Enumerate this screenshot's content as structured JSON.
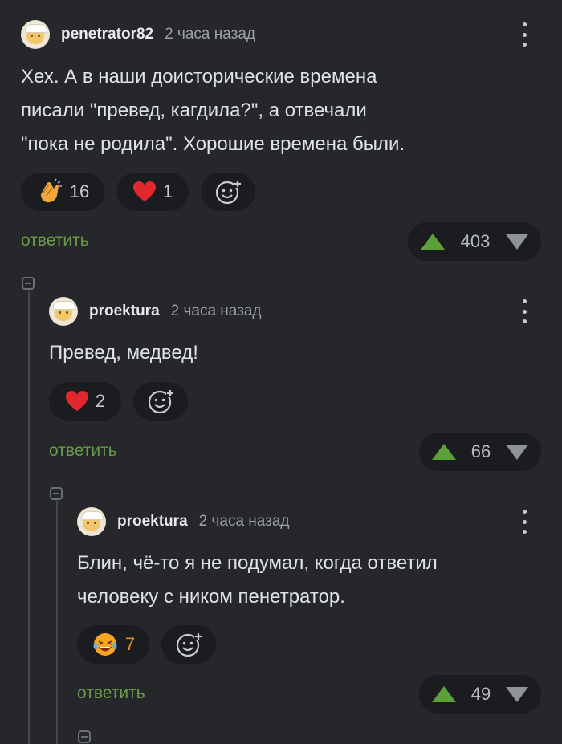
{
  "comments": [
    {
      "author": "penetrator82",
      "time": "2 часа назад",
      "lines": [
        "Хех. А в наши доисторические времена",
        "писали \"превед, кагдила?\", а отвечали",
        "\"пока не родила\". Хорошие времена были."
      ],
      "reactions": [
        {
          "icon": "clap-icon",
          "count": "16"
        },
        {
          "icon": "heart-icon",
          "count": "1"
        }
      ],
      "reply_label": "ответить",
      "rating": "403"
    },
    {
      "author": "proektura",
      "time": "2 часа назад",
      "lines": [
        "Превед, медвед!"
      ],
      "reactions": [
        {
          "icon": "heart-icon",
          "count": "2"
        }
      ],
      "reply_label": "ответить",
      "rating": "66"
    },
    {
      "author": "proektura",
      "time": "2 часа назад",
      "lines": [
        "Блин, чё-то я не подумал, когда ответил",
        "человеку с ником пенетратор."
      ],
      "reactions": [
        {
          "icon": "laugh-icon",
          "count": "7"
        }
      ],
      "reply_label": "ответить",
      "rating": "49"
    }
  ],
  "colors": {
    "background": "#25272b",
    "reply": "#6a9a4a",
    "upvote": "#5da03a",
    "laugh_count": "#e08a2a"
  }
}
